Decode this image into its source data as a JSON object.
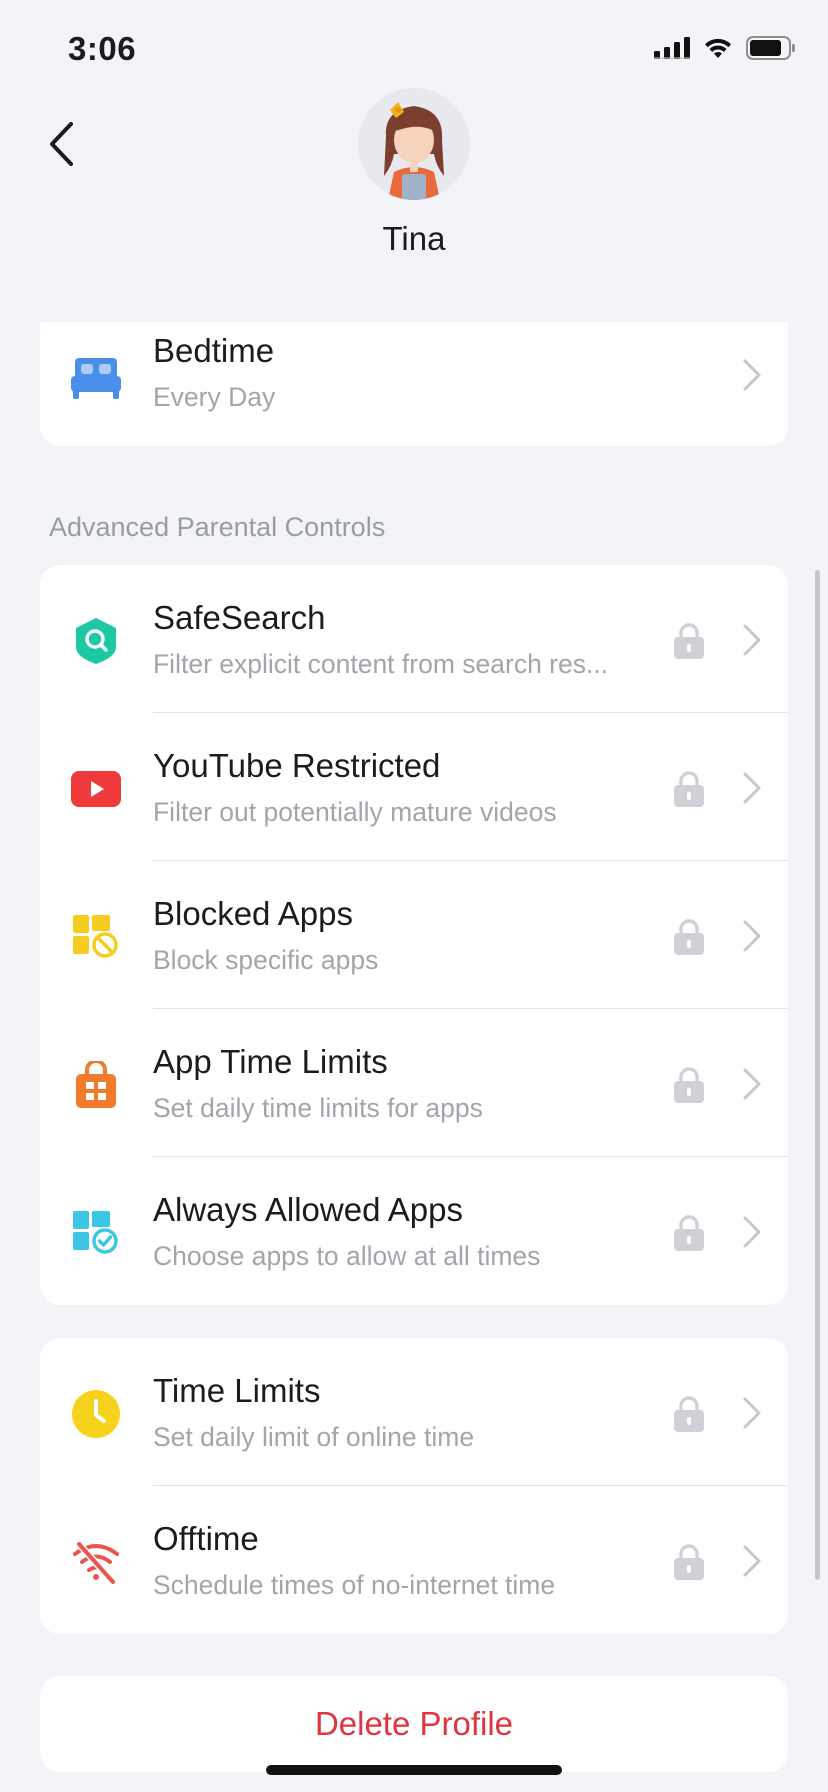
{
  "status_bar": {
    "time": "3:06"
  },
  "profile": {
    "name": "Tina"
  },
  "bedtime": {
    "title": "Bedtime",
    "subtitle": "Every Day",
    "icon": "bed-icon",
    "color": "#4a90e8"
  },
  "advanced": {
    "section_label": "Advanced Parental Controls",
    "items": [
      {
        "title": "SafeSearch",
        "subtitle": "Filter explicit content from search res...",
        "icon": "shield-search-icon",
        "color": "#1dc9a5",
        "locked": true
      },
      {
        "title": "YouTube Restricted",
        "subtitle": "Filter out potentially mature videos",
        "icon": "youtube-icon",
        "color": "#ee3a3a",
        "locked": true
      },
      {
        "title": "Blocked Apps",
        "subtitle": "Block specific apps",
        "icon": "blocked-apps-icon",
        "color": "#f5cc1f",
        "locked": true
      },
      {
        "title": "App Time Limits",
        "subtitle": "Set daily time limits for apps",
        "icon": "app-time-limit-icon",
        "color": "#f27a2a",
        "locked": true
      },
      {
        "title": "Always Allowed Apps",
        "subtitle": "Choose apps to allow at all times",
        "icon": "allowed-apps-icon",
        "color": "#3cc6e6",
        "locked": true
      }
    ]
  },
  "time_controls": {
    "items": [
      {
        "title": "Time Limits",
        "subtitle": "Set daily limit of online time",
        "icon": "clock-icon",
        "color": "#f5d21c",
        "locked": true
      },
      {
        "title": "Offtime",
        "subtitle": "Schedule times of no-internet time",
        "icon": "no-wifi-icon",
        "color": "#ef5350",
        "locked": true
      }
    ]
  },
  "delete_profile_label": "Delete Profile",
  "colors": {
    "accent_red": "#e0343f",
    "background": "#f3f4f8",
    "secondary_text": "#a3a5ab"
  }
}
